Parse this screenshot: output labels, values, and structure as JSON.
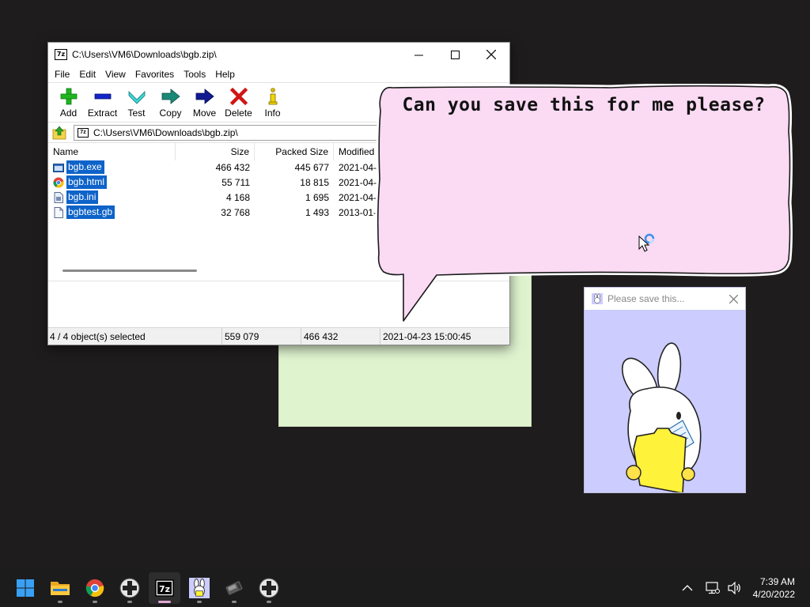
{
  "colors": {
    "desktop": "#1f1c1d",
    "selection": "#0d63c9",
    "bubble_fill": "#fbdaf3",
    "popup_bg": "#ccccff",
    "sticky_note": "#dff3cf",
    "taskbar": "#1c1c1c"
  },
  "sevenzip": {
    "title": "C:\\Users\\VM6\\Downloads\\bgb.zip\\",
    "app_icon_text": "7z",
    "menu": [
      "File",
      "Edit",
      "View",
      "Favorites",
      "Tools",
      "Help"
    ],
    "toolbar": [
      {
        "label": "Add",
        "icon": "plus-icon"
      },
      {
        "label": "Extract",
        "icon": "minus-icon"
      },
      {
        "label": "Test",
        "icon": "test-chevron-icon"
      },
      {
        "label": "Copy",
        "icon": "copy-arrow-icon"
      },
      {
        "label": "Move",
        "icon": "move-arrow-icon"
      },
      {
        "label": "Delete",
        "icon": "delete-x-icon"
      },
      {
        "label": "Info",
        "icon": "info-icon"
      }
    ],
    "address": "C:\\Users\\VM6\\Downloads\\bgb.zip\\",
    "columns": {
      "name": "Name",
      "size": "Size",
      "packed": "Packed Size",
      "modified": "Modified"
    },
    "files": [
      {
        "name": "bgb.exe",
        "size": "466 432",
        "packed": "445 677",
        "modified": "2021-04-",
        "icon": "exe-icon"
      },
      {
        "name": "bgb.html",
        "size": "55 711",
        "packed": "18 815",
        "modified": "2021-04-",
        "icon": "chrome-doc-icon"
      },
      {
        "name": "bgb.ini",
        "size": "4 168",
        "packed": "1 695",
        "modified": "2021-04-",
        "icon": "ini-file-icon"
      },
      {
        "name": "bgbtest.gb",
        "size": "32 768",
        "packed": "1 493",
        "modified": "2013-01-",
        "icon": "file-icon"
      }
    ],
    "status": {
      "selected": "4 / 4 object(s) selected",
      "total_size": "559 079",
      "selected_size": "466 432",
      "date": "2021-04-23 15:00:45"
    }
  },
  "bubble": {
    "text": "Can you save this for me please?"
  },
  "popup": {
    "title": "Please save this..."
  },
  "taskbar": {
    "apps": [
      "start-windows-icon",
      "file-explorer-icon",
      "chrome-icon",
      "gamepad-icon",
      "sevenzip-icon",
      "bunny-app-icon",
      "gameboy-cartridge-icon",
      "gamepad-icon-2"
    ],
    "clock_time": "7:39 AM",
    "clock_date": "4/20/2022"
  }
}
